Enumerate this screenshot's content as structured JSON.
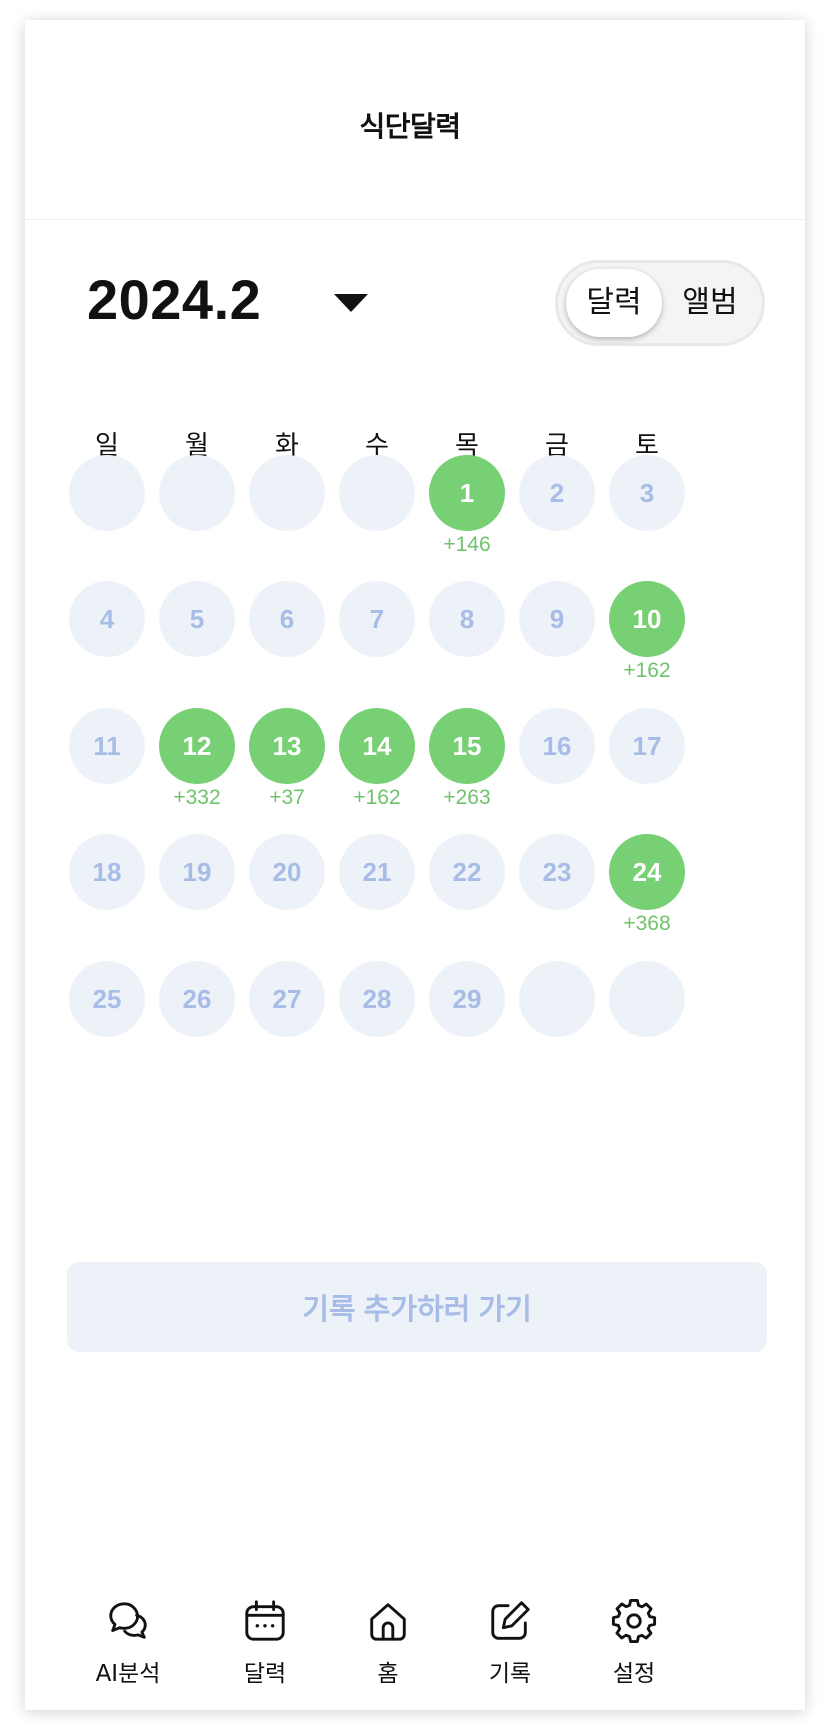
{
  "header": {
    "title": "식단달력"
  },
  "month": {
    "label": "2024.2"
  },
  "view_toggle": {
    "calendar": "달력",
    "album": "앨범",
    "selected": "달력"
  },
  "weekdays": [
    "일",
    "월",
    "화",
    "수",
    "목",
    "금",
    "토"
  ],
  "calendar": [
    [
      {
        "day": ""
      },
      {
        "day": ""
      },
      {
        "day": ""
      },
      {
        "day": ""
      },
      {
        "day": "1",
        "kcal": "+146"
      },
      {
        "day": "2"
      },
      {
        "day": "3"
      }
    ],
    [
      {
        "day": "4"
      },
      {
        "day": "5"
      },
      {
        "day": "6"
      },
      {
        "day": "7"
      },
      {
        "day": "8"
      },
      {
        "day": "9"
      },
      {
        "day": "10",
        "kcal": "+162"
      }
    ],
    [
      {
        "day": "11"
      },
      {
        "day": "12",
        "kcal": "+332"
      },
      {
        "day": "13",
        "kcal": "+37"
      },
      {
        "day": "14",
        "kcal": "+162"
      },
      {
        "day": "15",
        "kcal": "+263"
      },
      {
        "day": "16"
      },
      {
        "day": "17"
      }
    ],
    [
      {
        "day": "18"
      },
      {
        "day": "19"
      },
      {
        "day": "20"
      },
      {
        "day": "21"
      },
      {
        "day": "22"
      },
      {
        "day": "23"
      },
      {
        "day": "24",
        "kcal": "+368"
      }
    ],
    [
      {
        "day": "25"
      },
      {
        "day": "26"
      },
      {
        "day": "27"
      },
      {
        "day": "28"
      },
      {
        "day": "29"
      },
      {
        "day": ""
      },
      {
        "day": ""
      }
    ]
  ],
  "cta": {
    "label": "기록 추가하러 가기"
  },
  "tabs": [
    {
      "label": "AI분석",
      "icon": "chat-bubbles-icon"
    },
    {
      "label": "달력",
      "icon": "calendar-icon"
    },
    {
      "label": "홈",
      "icon": "home-icon"
    },
    {
      "label": "기록",
      "icon": "edit-icon"
    },
    {
      "label": "설정",
      "icon": "gear-icon"
    }
  ],
  "colors": {
    "recorded": "#78d075",
    "kcal_text": "#6fc36a",
    "empty_day": "#edf2f8",
    "day_text": "#a7bce6"
  }
}
